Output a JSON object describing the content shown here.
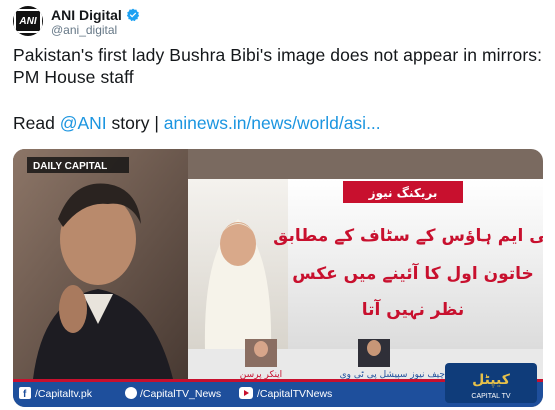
{
  "tweet": {
    "display_name": "ANI Digital",
    "handle": "@ani_digital",
    "avatar_text": "ANI",
    "text_line": "Pakistan's first lady Bushra Bibi's image does not appear in mirrors: PM House staff",
    "read_prefix": "Read",
    "mention": "@ANI",
    "read_mid": "story |",
    "link_text": "aninews.in/news/world/asi..."
  },
  "media": {
    "channel_logo": "DAILY CAPITAL",
    "breaking_label": "بریکنگ نیوز",
    "headline_line1": "پی ایم ہاؤس کے سٹاف کے مطابق",
    "headline_line2": "خاتون اول کا آئینے میں عکس",
    "headline_line3": "نظر نہیں آتا",
    "anchor_label": "اینکر پرسن",
    "reporter_label": "بیورو چیف نیوز سپیشل پی ٹی وی",
    "ticker_facebook": "/Capitaltv.pk",
    "ticker_twitter": "/CapitalTV_News",
    "ticker_youtube": "/CapitalTVNews",
    "corner_logo_urdu": "کیپٹل",
    "corner_logo_en": "CAPITAL TV",
    "colors": {
      "headline_red": "#c8102e",
      "ticker_blue": "#1e4f9c",
      "link_blue": "#1b95e0"
    }
  }
}
